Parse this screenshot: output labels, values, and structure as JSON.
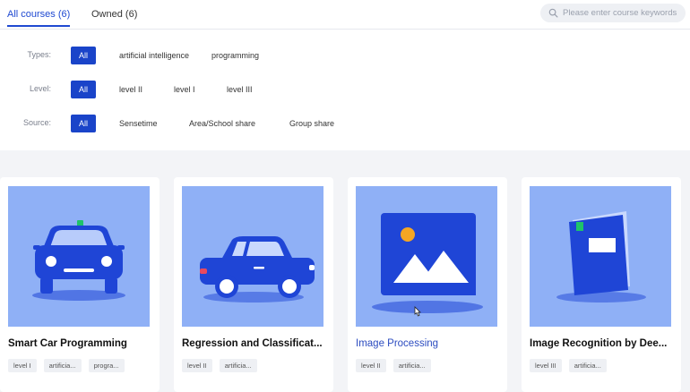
{
  "tabs": {
    "all_label": "All courses (6)",
    "owned_label": "Owned (6)"
  },
  "search": {
    "placeholder": "Please enter course keywords",
    "icon": "search-icon"
  },
  "filters": {
    "types": {
      "label": "Types:",
      "options": [
        "All",
        "artificial intelligence",
        "programming"
      ],
      "selected": "All"
    },
    "level": {
      "label": "Level:",
      "options": [
        "All",
        "level II",
        "level I",
        "level III"
      ],
      "selected": "All"
    },
    "source": {
      "label": "Source:",
      "options": [
        "All",
        "Sensetime",
        "Area/School share",
        "Group share"
      ],
      "selected": "All"
    }
  },
  "courses": [
    {
      "title": "Smart Car Programming",
      "image": "car-front-icon",
      "tags": [
        "level I",
        "artificia...",
        "progra..."
      ]
    },
    {
      "title": "Regression and Classificat...",
      "image": "car-side-icon",
      "tags": [
        "level II",
        "artificia..."
      ]
    },
    {
      "title": "Image Processing",
      "image": "image-landscape-icon",
      "tags": [
        "level II",
        "artificia..."
      ]
    },
    {
      "title": "Image Recognition by Dee...",
      "image": "book-icon",
      "tags": [
        "level III",
        "artificia..."
      ]
    }
  ],
  "colors": {
    "accent": "#1a44c9",
    "thumb_bg": "#8fb0f6",
    "illustration_blue": "#1f45d6",
    "badge_green": "#1fc36a",
    "sun_orange": "#f5a623"
  }
}
